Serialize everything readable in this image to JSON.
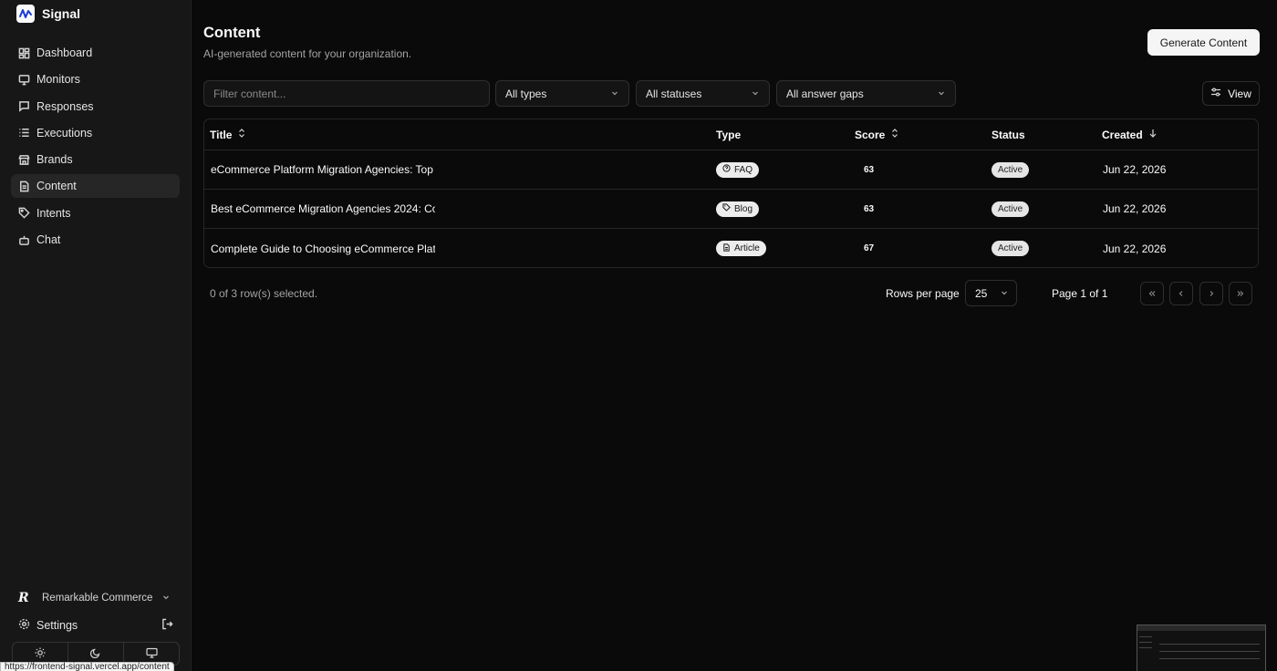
{
  "app": {
    "name": "Signal"
  },
  "sidebar": {
    "items": [
      {
        "label": "Dashboard",
        "icon": "dashboard-icon"
      },
      {
        "label": "Monitors",
        "icon": "monitor-icon"
      },
      {
        "label": "Responses",
        "icon": "message-icon"
      },
      {
        "label": "Executions",
        "icon": "list-icon"
      },
      {
        "label": "Brands",
        "icon": "store-icon"
      },
      {
        "label": "Content",
        "icon": "file-text-icon",
        "active": true
      },
      {
        "label": "Intents",
        "icon": "tag-icon"
      },
      {
        "label": "Chat",
        "icon": "bot-icon"
      }
    ],
    "org": {
      "name": "Remarkable Commerce",
      "logo_letter": "R"
    },
    "settings_label": "Settings",
    "theme": [
      "light",
      "dark",
      "system"
    ]
  },
  "url_tooltip": "https://frontend-signal.vercel.app/content",
  "header": {
    "title": "Content",
    "subtitle": "AI-generated content for your organization.",
    "generate_label": "Generate Content"
  },
  "filters": {
    "search_placeholder": "Filter content...",
    "type": "All types",
    "status": "All statuses",
    "answer_gap": "All answer gaps",
    "view_label": "View"
  },
  "table": {
    "columns": {
      "title": "Title",
      "type": "Type",
      "score": "Score",
      "status": "Status",
      "created": "Created"
    },
    "rows": [
      {
        "title": "eCommerce Platform Migration Agencies: Top",
        "type": "FAQ",
        "type_icon": "help-circle-icon",
        "score": "63",
        "status": "Active",
        "created": "Jun 22, 2026"
      },
      {
        "title": "Best eCommerce Migration Agencies 2024: Co",
        "type": "Blog",
        "type_icon": "tag-icon",
        "score": "63",
        "status": "Active",
        "created": "Jun 22, 2026"
      },
      {
        "title": "Complete Guide to Choosing eCommerce Platf",
        "type": "Article",
        "type_icon": "file-text-icon",
        "score": "67",
        "status": "Active",
        "created": "Jun 22, 2026"
      }
    ]
  },
  "footer": {
    "selected": "0 of 3 row(s) selected.",
    "rows_per_page_label": "Rows per page",
    "rows_per_page": "25",
    "page_info": "Page 1 of 1"
  },
  "colors": {
    "background": "#0a0a0a",
    "sidebar": "#171717",
    "badge": "#ececec",
    "border": "#262626"
  }
}
